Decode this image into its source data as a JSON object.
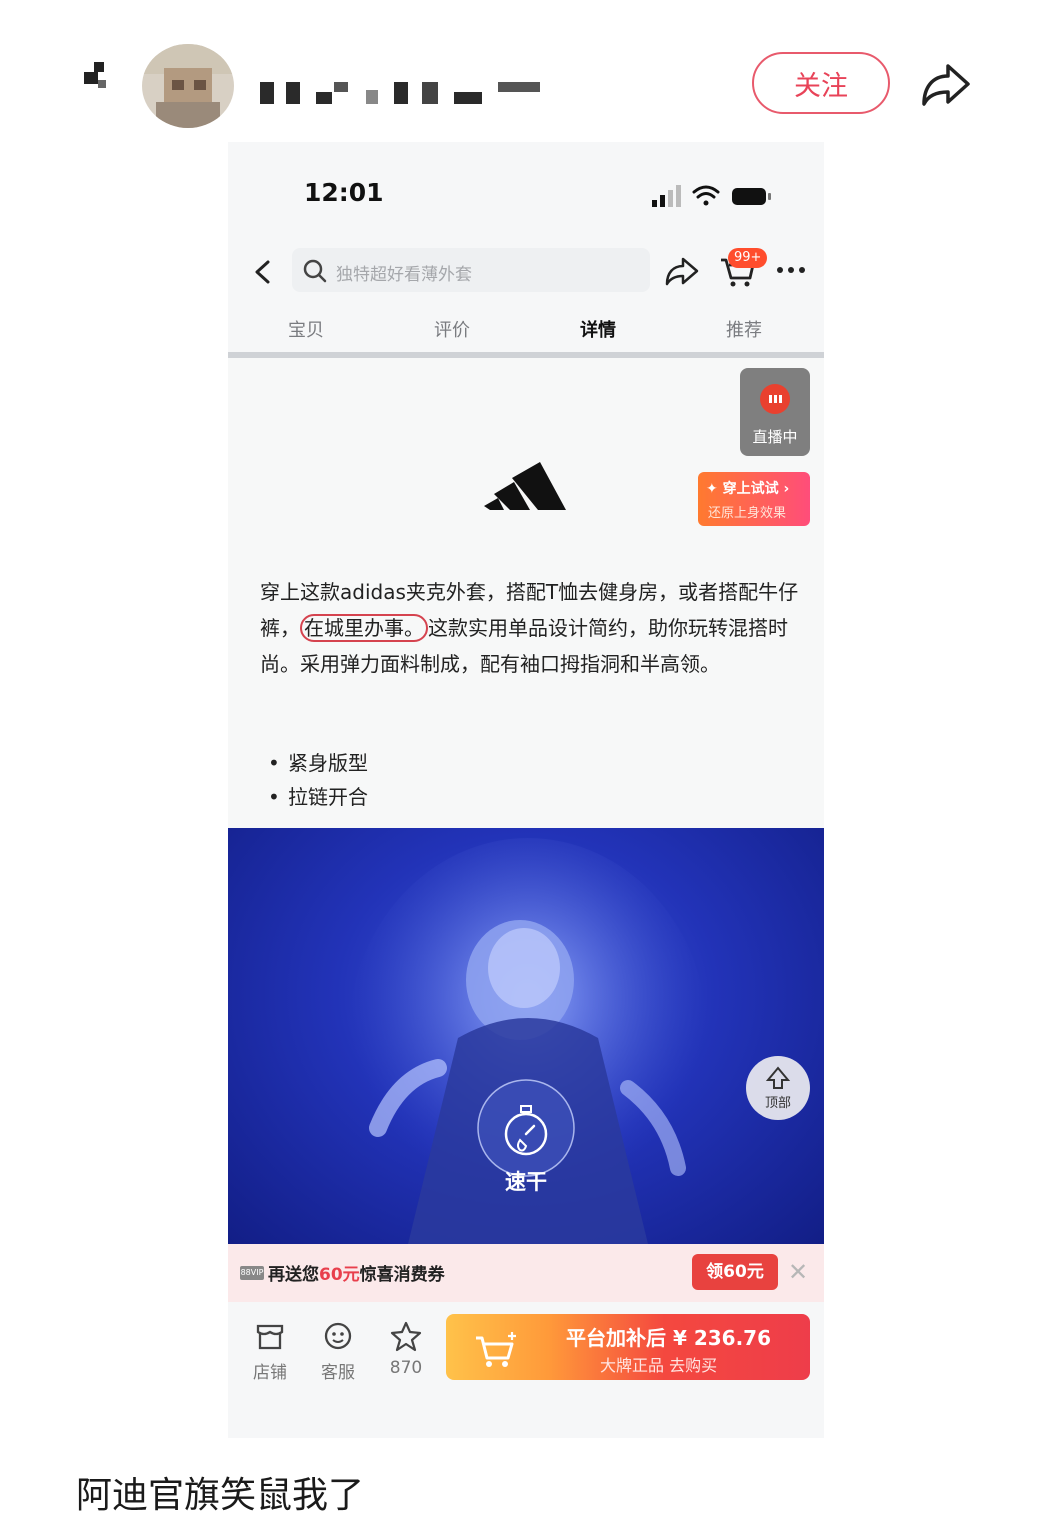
{
  "post": {
    "follow_label": "关注",
    "caption": "阿迪官旗笑鼠我了"
  },
  "phone": {
    "status_time": "12:01",
    "search_placeholder": "独特超好看薄外套",
    "cart_badge": "99+",
    "tabs": [
      {
        "label": "宝贝"
      },
      {
        "label": "评价"
      },
      {
        "label": "详情",
        "active": true
      },
      {
        "label": "推荐"
      }
    ],
    "live_label": "直播中",
    "tryon": {
      "title": "✦ 穿上试试 ›",
      "subtitle": "还原上身效果"
    },
    "description": {
      "before": "穿上这款adidas夹克外套，搭配T恤去健身房，或者搭配牛仔裤，",
      "highlight": "在城里办事。",
      "after": "这款实用单品设计简约，助你玩转混搭时尚。采用弹力面料制成，配有袖口拇指洞和半高领。"
    },
    "bullets": [
      "紧身版型",
      "拉链开合"
    ],
    "to_top_label": "顶部",
    "quick_dry_label": "速干",
    "coupon": {
      "icon_text": "88VIP",
      "prefix": "再送您",
      "amount": "60元",
      "suffix": "惊喜消费券",
      "claim_label": "领60元",
      "close": "✕"
    },
    "bottom": {
      "store_label": "店铺",
      "service_label": "客服",
      "favorites_count": "870",
      "buy_line1": "平台加补后 ¥ 236.76",
      "buy_line2": "大牌正品  去购买"
    }
  },
  "colors": {
    "accent_red": "#e84358",
    "buy_gradient_start": "#ffc24a",
    "buy_gradient_end": "#ee3d4a",
    "photo_blue": "#2233b8"
  }
}
